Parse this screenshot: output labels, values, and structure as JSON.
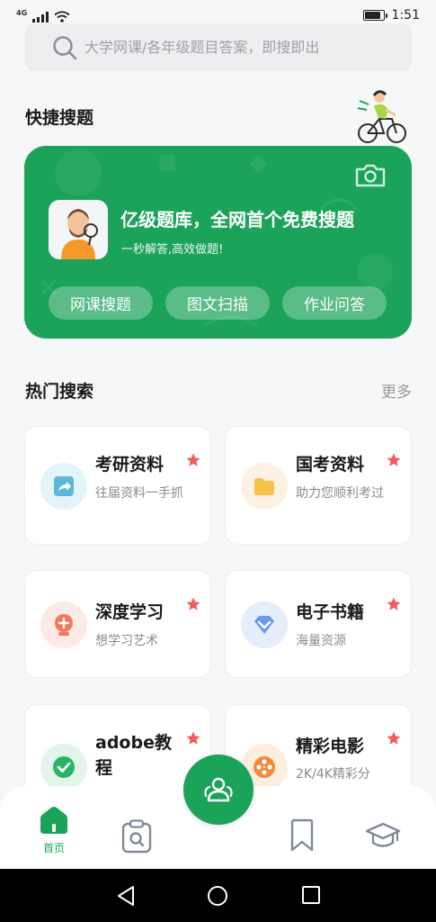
{
  "status_bar": {
    "network_label": "4G",
    "time": "1:51",
    "battery_level": 0.8
  },
  "search": {
    "placeholder": "大学网课/各年级题目答案，即搜即出"
  },
  "quick_search": {
    "title": "快捷搜题",
    "card": {
      "headline": "亿级题库，全网首个免费搜题",
      "subtitle": "一秒解答,高效做题!",
      "buttons": [
        "网课搜题",
        "图文扫描",
        "作业问答"
      ]
    }
  },
  "hot_search": {
    "title": "热门搜索",
    "more_label": "更多",
    "items": [
      {
        "title": "考研资料",
        "desc": "往届资料一手抓",
        "icon": "share-doc-icon"
      },
      {
        "title": "国考资料",
        "desc": "助力您顺利考过",
        "icon": "folder-icon"
      },
      {
        "title": "深度学习",
        "desc": "想学习艺术",
        "icon": "plus-circle-icon"
      },
      {
        "title": "电子书籍",
        "desc": "海量资源",
        "icon": "diamond-icon"
      },
      {
        "title": "adobe教程",
        "desc": "",
        "icon": "check-circle-icon"
      },
      {
        "title": "精彩电影",
        "desc": "2K/4K精彩分",
        "icon": "film-reel-icon"
      }
    ]
  },
  "bottom_nav": {
    "home_label": "首页"
  },
  "colors": {
    "accent": "#1ba35a",
    "star": "#f05b5b",
    "background": "#f6f7f9"
  }
}
